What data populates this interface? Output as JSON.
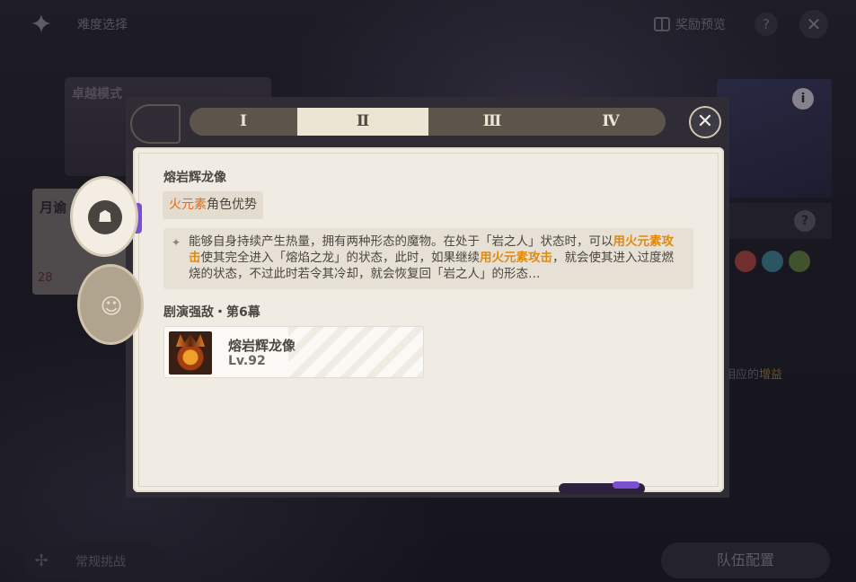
{
  "header": {
    "title": "难度选择",
    "reward_label": "奖励预览",
    "help_label": "?",
    "close_label": "✕"
  },
  "background": {
    "mode_label": "卓越模式",
    "moon_label": "月谕",
    "moon_count": "28",
    "info_label": "i",
    "help_label": "?",
    "right_text_prefix": "相应的",
    "right_text_highlight": "增益",
    "challenge_label": "常规挑战",
    "team_label": "队伍配置",
    "element_colors": [
      "#a6443f",
      "#3f7f93",
      "#5f7a3f"
    ]
  },
  "modal": {
    "tabs": [
      {
        "label": "Ⅰ",
        "active": false
      },
      {
        "label": "Ⅱ",
        "active": true
      },
      {
        "label": "Ⅲ",
        "active": false
      },
      {
        "label": "Ⅳ",
        "active": false
      }
    ],
    "close_label": "✕",
    "enemy_title": "熔岩辉龙像",
    "advantage_element": "火元素",
    "advantage_suffix": "角色优势",
    "description": {
      "p1": "能够自身持续产生热量，拥有两种形态的魔物。在处于「岩之人」状态时，可以",
      "h1": "用火元素攻击",
      "p2": "使其完全进入「熔焰之龙」的状态，此时，如果继续",
      "h2": "用火元素攻击",
      "p3": "，就会使其进入过度燃烧的状态，不过此时若令其冷却，就会恢复回「岩之人」的形态…"
    },
    "section_title": "剧演强敌・第6幕",
    "enemy_card": {
      "name": "熔岩辉龙像",
      "level": "Lv.92"
    }
  },
  "colors": {
    "accent_fire": "#e06b1c",
    "highlight": "#e08a10",
    "panel_bg": "#f1ece3",
    "active_tab": "#ede5d4"
  }
}
